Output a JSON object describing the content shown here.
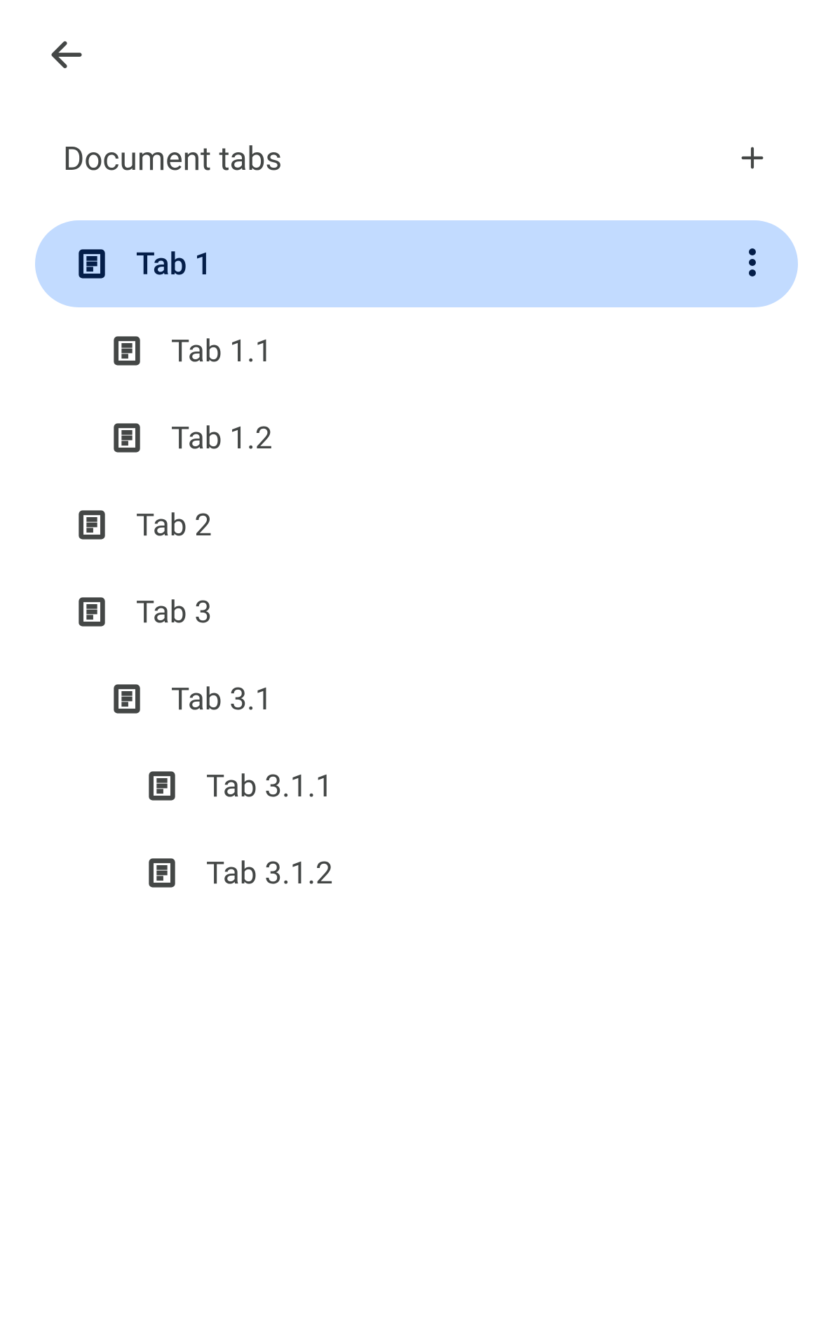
{
  "header": {
    "title": "Document tabs"
  },
  "tabs": [
    {
      "label": "Tab 1",
      "indent": 0,
      "active": true
    },
    {
      "label": "Tab 1.1",
      "indent": 1,
      "active": false
    },
    {
      "label": "Tab 1.2",
      "indent": 1,
      "active": false
    },
    {
      "label": "Tab 2",
      "indent": 0,
      "active": false
    },
    {
      "label": "Tab 3",
      "indent": 0,
      "active": false
    },
    {
      "label": "Tab 3.1",
      "indent": 1,
      "active": false
    },
    {
      "label": "Tab 3.1.1",
      "indent": 2,
      "active": false
    },
    {
      "label": "Tab 3.1.2",
      "indent": 2,
      "active": false
    }
  ]
}
